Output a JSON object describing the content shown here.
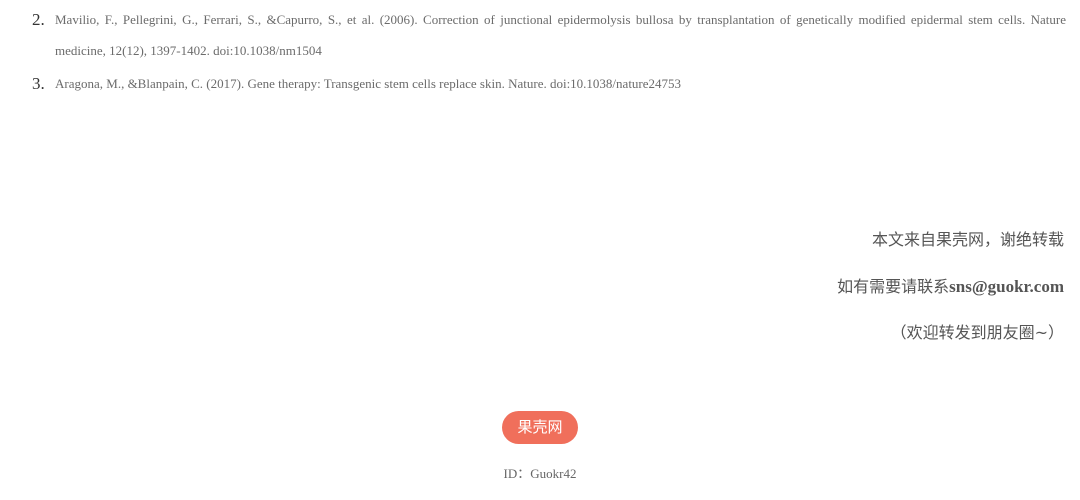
{
  "references": [
    {
      "number": "2.",
      "text": "Mavilio, F., Pellegrini, G., Ferrari, S., &Capurro, S., et al. (2006). Correction of junctional epidermolysis bullosa by transplantation of genetically modified epidermal stem cells. Nature medicine, 12(12), 1397-1402. doi:10.1038/nm1504"
    },
    {
      "number": "3.",
      "text": "Aragona, M., &Blanpain, C. (2017). Gene therapy: Transgenic stem cells replace skin. Nature. doi:10.1038/nature24753"
    }
  ],
  "footer": {
    "source_note": "本文来自果壳网，谢绝转载",
    "contact_prefix": "如有需要请联系",
    "contact_email": "sns@guokr.com",
    "share_note": "（欢迎转发到朋友圈~）"
  },
  "brand": {
    "label": "果壳网",
    "id_text": "ID：Guokr42",
    "accent_color": "#f06f5b"
  }
}
